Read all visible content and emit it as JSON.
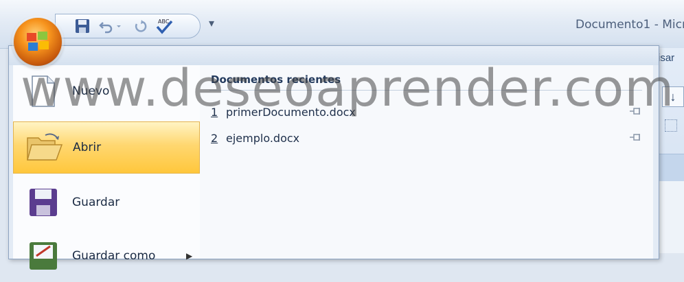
{
  "title_bar": {
    "document_title": "Documento1 - Micr",
    "qat_more_glyph": "▾"
  },
  "ribbon_partial": {
    "tab_fragment": "isar",
    "sort_glyph": "↓"
  },
  "office_menu": {
    "commands": [
      {
        "label": "Nuevo",
        "icon": "new-document-icon"
      },
      {
        "label": "Abrir",
        "icon": "open-folder-icon",
        "selected": true
      },
      {
        "label": "Guardar",
        "icon": "save-floppy-icon"
      },
      {
        "label": "Guardar como",
        "icon": "save-as-icon",
        "submenu_arrow": "▶"
      }
    ],
    "recent": {
      "heading": "Documentos recientes",
      "items": [
        {
          "number": "1",
          "name": "primerDocumento.docx"
        },
        {
          "number": "2",
          "name": "ejemplo.docx"
        }
      ]
    }
  },
  "watermark": "www.deseoaprender.com",
  "colors": {
    "selection": "#ffc73c",
    "accent": "#f7941d",
    "menu_bg": "#e3ebf5"
  }
}
